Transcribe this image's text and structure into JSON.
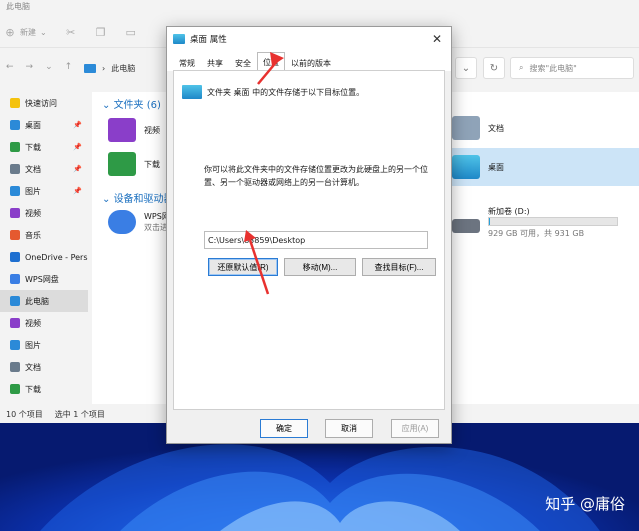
{
  "explorer": {
    "title": "此电脑",
    "cmd": {
      "new_label": "新建"
    },
    "address": {
      "path": "此电脑"
    },
    "search": {
      "placeholder": "搜索\"此电脑\""
    },
    "sidebar": [
      {
        "label": "快速访问",
        "icon": "star-icon",
        "color": "#f4c20d"
      },
      {
        "label": "桌面",
        "icon": "desktop-icon",
        "color": "#2b8ad8",
        "pinned": true
      },
      {
        "label": "下载",
        "icon": "download-icon",
        "color": "#2e9a46",
        "pinned": true
      },
      {
        "label": "文档",
        "icon": "document-icon",
        "color": "#6a7b8c",
        "pinned": true
      },
      {
        "label": "图片",
        "icon": "picture-icon",
        "color": "#2b8ad8",
        "pinned": true
      },
      {
        "label": "视频",
        "icon": "video-icon",
        "color": "#8a3ec9"
      },
      {
        "label": "音乐",
        "icon": "music-icon",
        "color": "#e5592f"
      },
      {
        "label": "OneDrive - Pers",
        "icon": "cloud-icon",
        "color": "#1e6fd0"
      },
      {
        "label": "WPS网盘",
        "icon": "cloud-icon",
        "color": "#3a7ee4"
      },
      {
        "label": "此电脑",
        "icon": "computer-icon",
        "color": "#2b8ad8",
        "selected": true
      },
      {
        "label": "视频",
        "icon": "video-icon",
        "color": "#8a3ec9"
      },
      {
        "label": "图片",
        "icon": "picture-icon",
        "color": "#2b8ad8"
      },
      {
        "label": "文档",
        "icon": "document-icon",
        "color": "#6a7b8c"
      },
      {
        "label": "下载",
        "icon": "download-icon",
        "color": "#2e9a46"
      }
    ],
    "groups": {
      "folders": "文件夹 (6)",
      "devices": "设备和驱动器"
    },
    "folders": [
      {
        "label": "视频"
      },
      {
        "label": "下载"
      },
      {
        "label": "文档"
      },
      {
        "label": "桌面"
      }
    ],
    "devices": [
      {
        "label": "WPS网",
        "sub": "双击进"
      },
      {
        "label": "新加卷 (D:)",
        "sub": "929 GB 可用，共 931 GB",
        "used_fraction": 0.002
      }
    ],
    "status": {
      "count": "10 个项目",
      "selected": "选中 1 个项目"
    }
  },
  "dialog": {
    "title": "桌面 属性",
    "tabs": [
      "常规",
      "共享",
      "安全",
      "位置",
      "以前的版本"
    ],
    "active_tab": "位置",
    "location_line": "文件夹 桌面 中的文件存储于以下目标位置。",
    "description": "你可以将此文件夹中的文件存储位置更改为此硬盘上的另一个位置、另一个驱动器或网络上的另一台计算机。",
    "path": "C:\\Users\\83859\\Desktop",
    "buttons": {
      "restore": "还原默认值(R)",
      "move": "移动(M)...",
      "find": "查找目标(F)..."
    },
    "footer": {
      "ok": "确定",
      "cancel": "取消",
      "apply": "应用(A)"
    }
  },
  "watermark": "知乎 @庸俗",
  "colors": {
    "accent": "#2a7bd4",
    "annotation_arrow": "#e8312f"
  }
}
